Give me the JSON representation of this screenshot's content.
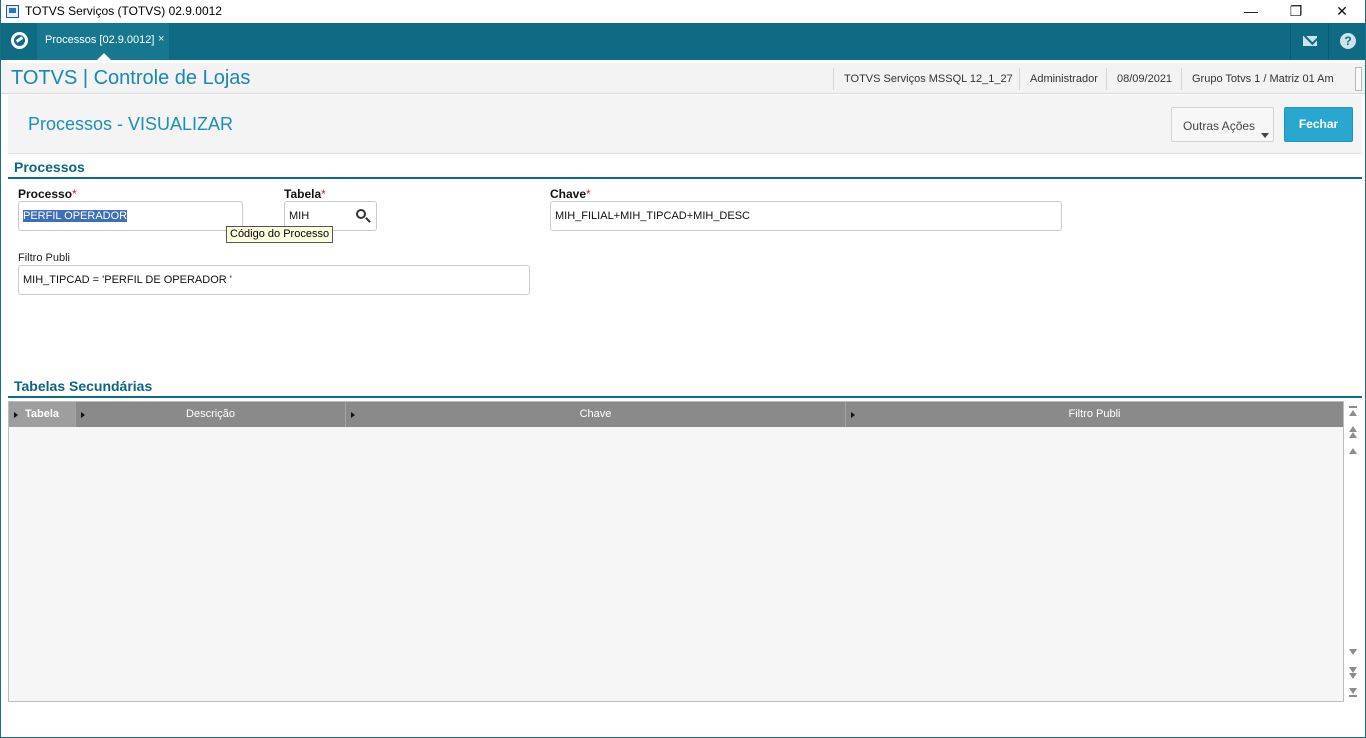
{
  "window": {
    "title": "TOTVS Serviços (TOTVS) 02.9.0012",
    "minimize_glyph": "—",
    "restore_glyph": "❐",
    "close_glyph": "✕"
  },
  "nav": {
    "tab_label": "Processos [02.9.0012]",
    "tab_close_glyph": "×",
    "help_glyph": "?",
    "icons": [
      "totvs-logo-icon",
      "mail-icon",
      "help-icon"
    ]
  },
  "header": {
    "app_title": "TOTVS | Controle de Lojas",
    "environment": "TOTVS Serviços MSSQL 12_1_27",
    "user": "Administrador",
    "date": "08/09/2021",
    "company": "Grupo Totvs 1 / Matriz 01 Am"
  },
  "page": {
    "title": "Processos - VISUALIZAR",
    "other_actions_label": "Outras Ações",
    "close_label": "Fechar"
  },
  "form": {
    "section_title": "Processos",
    "required_mark": "*",
    "processo": {
      "label": "Processo",
      "value": "PERFIL OPERADOR"
    },
    "tabela": {
      "label": "Tabela",
      "value": "MIH"
    },
    "chave": {
      "label": "Chave",
      "value": "MIH_FILIAL+MIH_TIPCAD+MIH_DESC"
    },
    "filtro": {
      "label": "Filtro Publi",
      "value": "MIH_TIPCAD = 'PERFIL DE OPERADOR  '"
    },
    "tooltip": "Código do Processo"
  },
  "grid": {
    "section_title": "Tabelas Secundárias",
    "columns": [
      "Tabela",
      "Descrição",
      "Chave",
      "Filtro Publi"
    ],
    "rows": []
  },
  "colors": {
    "nav_bg": "#0f6a84",
    "accent": "#1b85b5",
    "button_primary": "#29a7cf",
    "required": "#d81e1e"
  }
}
